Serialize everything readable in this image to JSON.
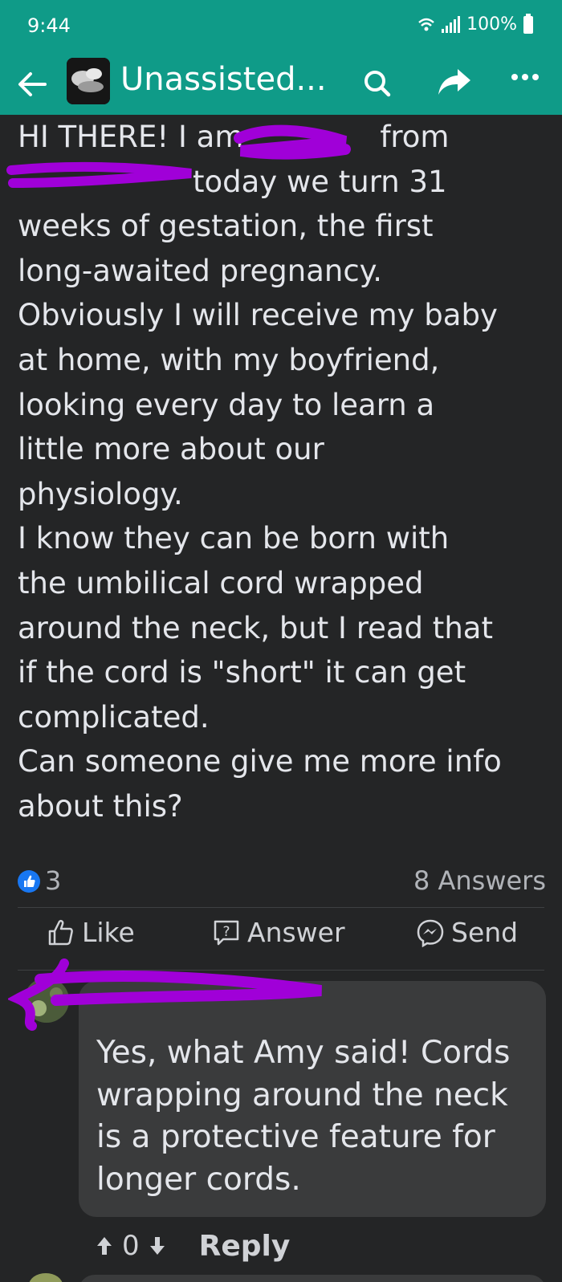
{
  "status_bar": {
    "time": "9:44",
    "battery": "100%",
    "icons": [
      "wifi-icon",
      "signal-icon",
      "battery-icon"
    ]
  },
  "header": {
    "group_title": "Unassisted...",
    "icons": [
      "back-arrow-icon",
      "search-icon",
      "share-icon",
      "more-icon"
    ],
    "background_color": "#0f9b88"
  },
  "post": {
    "lines": [
      "HI THERE! I am",
      "from",
      "today we turn 31",
      "weeks of gestation, the first",
      "long-awaited pregnancy.",
      "Obviously I will receive my baby",
      "at home, with my boyfriend,",
      "looking every day to learn a",
      "little more about our",
      "physiology.",
      "I know they can be born with",
      "the umbilical cord wrapped",
      "around the neck, but I read that",
      "if the cord is \"short\" it can get",
      "complicated.",
      "Can someone give me more info",
      "about this?"
    ],
    "redaction_color": "#a000d8"
  },
  "reactions": {
    "count": "3",
    "answers": "8 Answers"
  },
  "actions": {
    "like": "Like",
    "answer": "Answer",
    "send": "Send"
  },
  "comment": {
    "lines": [
      "Yes, what Amy said! Cords",
      "wrapping around the neck",
      "is a protective feature for",
      "longer cords."
    ],
    "votes": "0",
    "reply": "Reply"
  }
}
